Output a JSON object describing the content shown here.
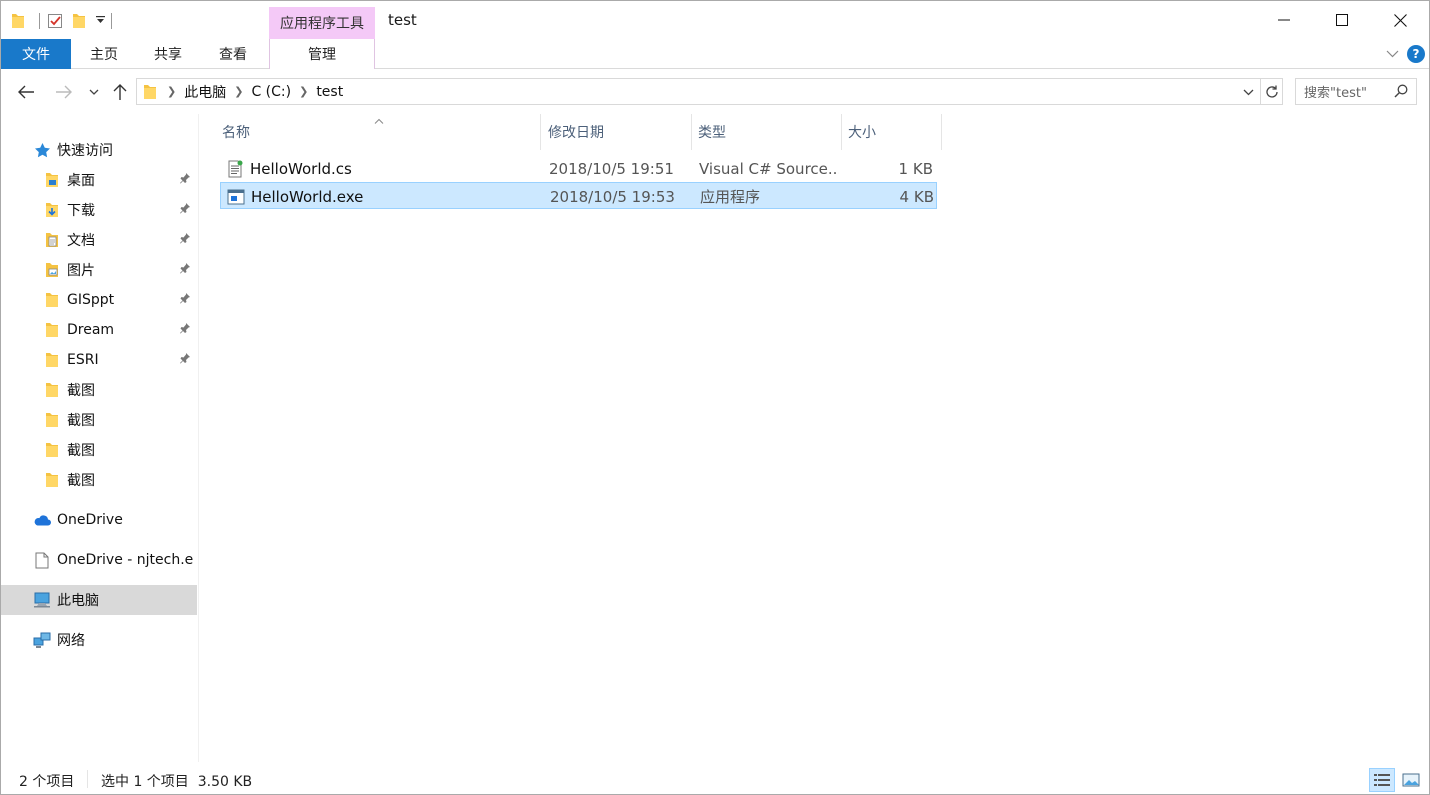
{
  "window": {
    "title": "test",
    "context_tab_group": "应用程序工具",
    "quick_access_icons": [
      "folder-icon",
      "properties-icon",
      "new-folder-icon",
      "customize-dropdown-icon"
    ]
  },
  "ribbon": {
    "tabs": [
      {
        "label": "文件"
      },
      {
        "label": "主页"
      },
      {
        "label": "共享"
      },
      {
        "label": "查看"
      },
      {
        "label": "管理"
      }
    ],
    "accent_color": "#1979ca",
    "context_color": "#f4c9f7"
  },
  "address": {
    "crumbs": [
      "此电脑",
      "C (C:)",
      "test"
    ],
    "search_placeholder": "搜索\"test\""
  },
  "nav": {
    "quick_access": "快速访问",
    "pinned": [
      {
        "label": "桌面",
        "icon": "desktop-folder-icon",
        "pinned": true
      },
      {
        "label": "下载",
        "icon": "download-folder-icon",
        "pinned": true
      },
      {
        "label": "文档",
        "icon": "documents-folder-icon",
        "pinned": true
      },
      {
        "label": "图片",
        "icon": "pictures-folder-icon",
        "pinned": true
      },
      {
        "label": "GISppt",
        "icon": "folder-icon",
        "pinned": true
      },
      {
        "label": "Dream",
        "icon": "folder-icon",
        "pinned": true
      },
      {
        "label": "ESRI",
        "icon": "folder-icon",
        "pinned": true
      },
      {
        "label": "截图",
        "icon": "folder-icon",
        "pinned": false
      },
      {
        "label": "截图",
        "icon": "folder-icon",
        "pinned": false
      },
      {
        "label": "截图",
        "icon": "folder-icon",
        "pinned": false
      },
      {
        "label": "截图",
        "icon": "folder-icon",
        "pinned": false
      }
    ],
    "onedrive": "OneDrive",
    "onedrive_org": "OneDrive - njtech.e",
    "this_pc": "此电脑",
    "network": "网络"
  },
  "files": {
    "columns": [
      "名称",
      "修改日期",
      "类型",
      "大小"
    ],
    "rows": [
      {
        "name": "HelloWorld.cs",
        "date": "2018/10/5 19:51",
        "type": "Visual C# Source...",
        "size": "1 KB",
        "selected": false
      },
      {
        "name": "HelloWorld.exe",
        "date": "2018/10/5 19:53",
        "type": "应用程序",
        "size": "4 KB",
        "selected": true
      }
    ]
  },
  "status": {
    "count": "2 个项目",
    "selection": "选中 1 个项目  3.50 KB"
  }
}
